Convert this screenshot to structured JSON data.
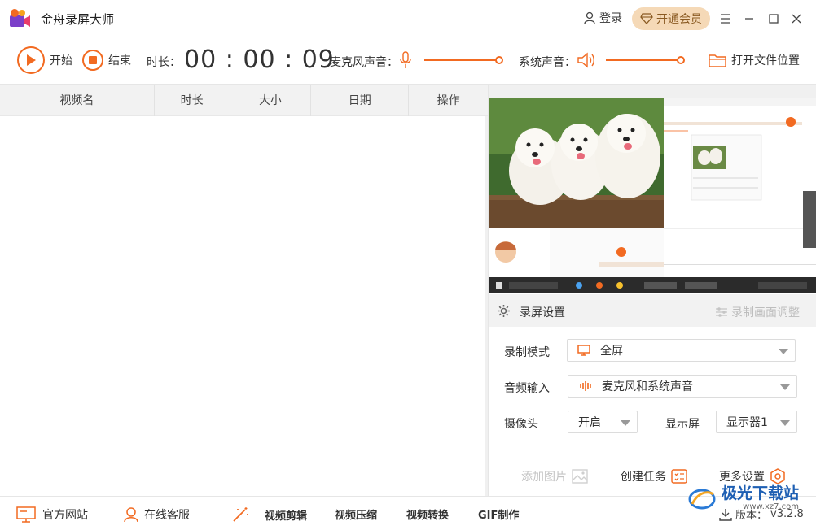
{
  "app": {
    "title": "金舟录屏大师"
  },
  "header": {
    "login_label": "登录",
    "vip_label": "开通会员"
  },
  "toolbar": {
    "start_label": "开始",
    "stop_label": "结束",
    "duration_label": "时长：",
    "duration_value": "00 : 00 : 09",
    "mic_label": "麦克风声音：",
    "mic_volume": 1.0,
    "system_label": "系统声音：",
    "system_volume": 1.0,
    "open_folder_label": "打开文件位置"
  },
  "list": {
    "columns": [
      "视频名",
      "时长",
      "大小",
      "日期",
      "操作"
    ],
    "rows": []
  },
  "settings": {
    "title": "录屏设置",
    "adjust_label": "录制画面调整",
    "mode_label": "录制模式",
    "mode_value": "全屏",
    "audio_label": "音频输入",
    "audio_value": "麦克风和系统声音",
    "camera_label": "摄像头",
    "camera_value": "开启",
    "display_label": "显示屏",
    "display_value": "显示器1",
    "add_image_label": "添加图片",
    "create_task_label": "创建任务",
    "more_settings_label": "更多设置"
  },
  "bottom": {
    "website_label": "官方网站",
    "support_label": "在线客服",
    "edit_label": "视频剪辑",
    "compress_label": "视频压缩",
    "convert_label": "视频转换",
    "gif_label": "GIF制作",
    "version_label": "版本：",
    "version_value": "v3.2.8"
  },
  "watermark": {
    "text": "极光下载站",
    "url": "www.xz7.com"
  },
  "colors": {
    "accent": "#f26a21",
    "vip_bg": "#f5d9b7",
    "header_bg": "#f2f2f2"
  }
}
